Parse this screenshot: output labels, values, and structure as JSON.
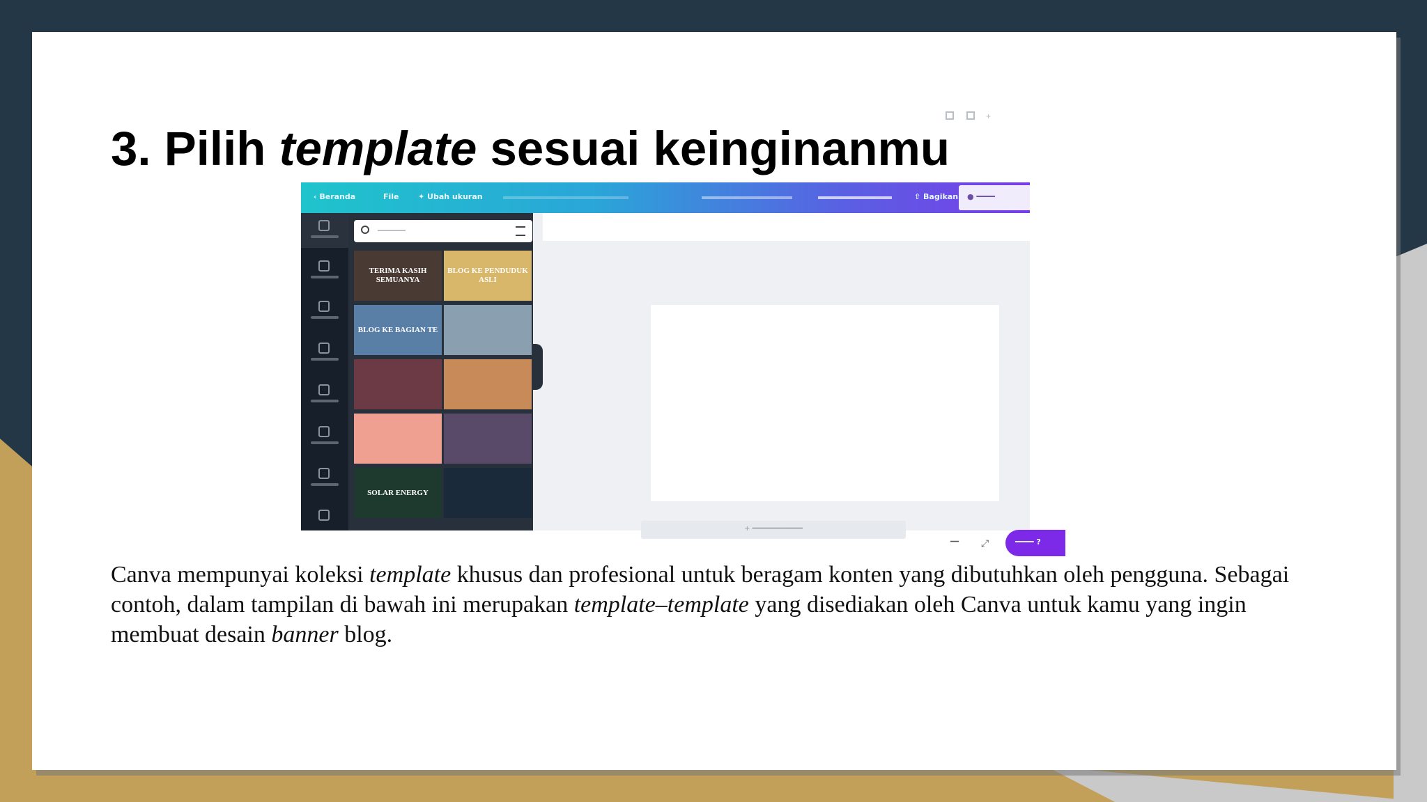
{
  "slide": {
    "title_prefix": "3. Pilih ",
    "title_italic": "template",
    "title_suffix": " sesuai keinginanmu",
    "body": {
      "t1": "Canva mempunyai koleksi ",
      "t2": "template",
      "t3": " khusus dan profesional untuk beragam konten yang dibutuhkan oleh pengguna. Sebagai contoh, dalam tampilan di bawah ini merupakan ",
      "t4": "template–template",
      "t5": " yang disediakan oleh Canva untuk kamu yang ingin membuat desain ",
      "t6": "banner",
      "t7": " blog."
    }
  },
  "colors": {
    "navy": "#233746",
    "gold": "#c2a05a",
    "canva_purple": "#7d2ae8",
    "canva_teal": "#1fc4cc"
  },
  "screenshot": {
    "topbar": {
      "home": "‹ Beranda",
      "file": "File",
      "resize": "✦ Ubah ukuran",
      "share": "⇧ Bagikan"
    },
    "thumbnails": [
      {
        "text": "TERIMA KASIH SEMUANYA",
        "bg": "#4a3a34"
      },
      {
        "text": "BLOG KE PENDUDUK ASLI",
        "bg": "#d8b76a"
      },
      {
        "text": "BLOG KE BAGIAN TE",
        "bg": "#5a7fa6"
      },
      {
        "text": "",
        "bg": "#8aa0b0"
      },
      {
        "text": "",
        "bg": "#6b3a45"
      },
      {
        "text": "",
        "bg": "#c98a5a"
      },
      {
        "text": "",
        "bg": "#f0a090"
      },
      {
        "text": "",
        "bg": "#5a4a6a"
      },
      {
        "text": "SOLAR ENERGY",
        "bg": "#1e3a2e"
      },
      {
        "text": "",
        "bg": "#1a2a3a"
      }
    ]
  }
}
